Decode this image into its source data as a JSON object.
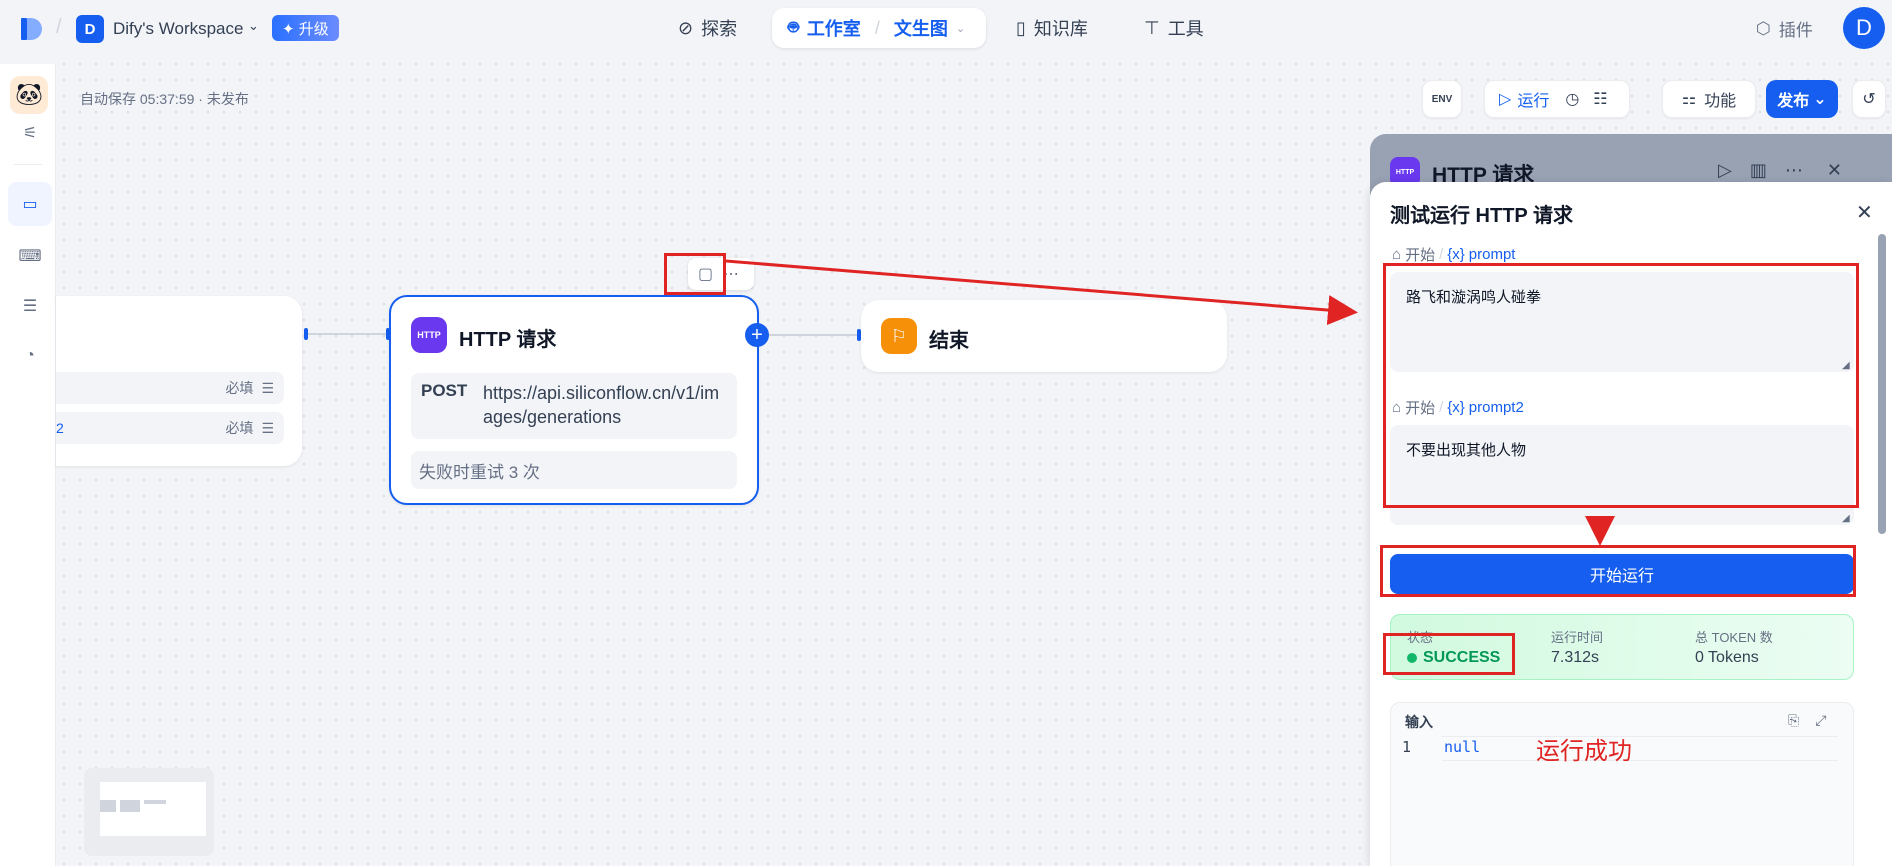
{
  "topbar": {
    "workspace_initial": "D",
    "workspace_name": "Dify's Workspace",
    "upgrade_label": "✦ 升级",
    "nav": {
      "explore": "探索",
      "studio": "工作室",
      "app_name": "文生图",
      "knowledge": "知识库",
      "tools": "工具"
    },
    "plugins_label": "插件",
    "user_initial": "D"
  },
  "canvas": {
    "autosave": "自动保存 05:37:59 · 未发布"
  },
  "toolbar": {
    "env_label": "ENV",
    "run_label": "运行",
    "features_label": "功能",
    "publish_label": "发布"
  },
  "start_node": {
    "rows": [
      {
        "badge": "",
        "required": "必填"
      },
      {
        "badge": "2",
        "required": "必填"
      }
    ]
  },
  "http_node": {
    "icon_text": "HTTP",
    "title": "HTTP 请求",
    "method": "POST",
    "url": "https://api.siliconflow.cn/v1/images/generations",
    "retry": "失败时重试 3 次"
  },
  "end_node": {
    "title": "结束"
  },
  "panel_back": {
    "icon_text": "HTTP",
    "title": "HTTP 请求"
  },
  "panel": {
    "title": "测试运行 HTTP 请求",
    "inputs": [
      {
        "source": "开始",
        "var_prefix": "{x}",
        "var": "prompt",
        "value": "路飞和漩涡鸣人碰拳"
      },
      {
        "source": "开始",
        "var_prefix": "{x}",
        "var": "prompt2",
        "value": "不要出现其他人物"
      }
    ],
    "run_button": "开始运行",
    "status": {
      "status_label": "状态",
      "status_value": "SUCCESS",
      "time_label": "运行时间",
      "time_value": "7.312s",
      "token_label": "总 TOKEN 数",
      "token_value": "0 Tokens"
    },
    "output": {
      "label": "输入",
      "line_number": "1",
      "code": "null"
    }
  },
  "annotation": {
    "text": "运行成功",
    "color": "#e02424"
  },
  "colors": {
    "primary": "#155eef",
    "success": "#039855",
    "end_node": "#f79009",
    "http_icon": "#6938ef"
  }
}
